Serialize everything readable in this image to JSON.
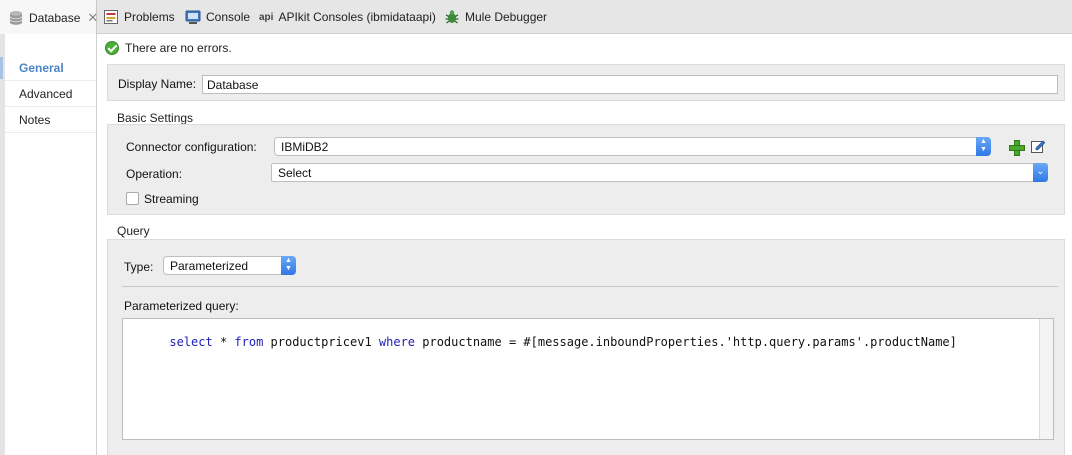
{
  "tabs": [
    {
      "label": "Database",
      "icon": "database-icon",
      "active": true
    },
    {
      "label": "Problems",
      "icon": "problems-icon"
    },
    {
      "label": "Console",
      "icon": "console-icon"
    },
    {
      "label": "APIkit Consoles (ibmidataapi)",
      "icon": "api-icon",
      "icon_text": "api"
    },
    {
      "label": "Mule Debugger",
      "icon": "debugger-icon"
    }
  ],
  "nav": {
    "items": [
      {
        "label": "General",
        "active": true
      },
      {
        "label": "Advanced"
      },
      {
        "label": "Notes"
      }
    ]
  },
  "status": {
    "message": "There are no errors."
  },
  "display_name": {
    "label": "Display Name:",
    "value": "Database"
  },
  "basic_settings": {
    "title": "Basic Settings",
    "connector_label": "Connector configuration:",
    "connector_value": "IBMiDB2",
    "operation_label": "Operation:",
    "operation_value": "Select",
    "streaming_label": "Streaming",
    "streaming_checked": false
  },
  "query": {
    "title": "Query",
    "type_label": "Type:",
    "type_value": "Parameterized",
    "param_label": "Parameterized query:",
    "sql": {
      "kw_select": "select",
      "t1": " * ",
      "kw_from": "from",
      "t2": " productpricev1 ",
      "kw_where": "where",
      "t3": " productname = #[message.inboundProperties.'http.query.params'.productName]"
    }
  },
  "colors": {
    "accent": "#4b86c4",
    "ok": "#4fae3a",
    "keyword": "#1d1db8"
  }
}
